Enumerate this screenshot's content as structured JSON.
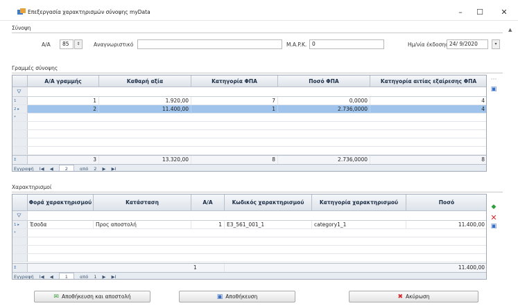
{
  "window": {
    "title": "Επεξεργασία χαρακτηρισμών σύνοψης myData",
    "controls": {
      "minimize": "–",
      "maximize": "☐",
      "close": "✕"
    }
  },
  "summary": {
    "label": "Σύνοψη",
    "aa_label": "Α/Α",
    "aa_value": "85",
    "id_label": "Αναγνωριστικό",
    "id_value": "",
    "mark_label": "M.A.P.K.",
    "mark_value": "0",
    "date_label": "Ημ/νία έκδοσης",
    "date_value": "24/ 9/2020"
  },
  "lines": {
    "label": "Γραμμές σύνοψης",
    "columns": [
      "Α/Α γραμμής",
      "Καθαρή αξία",
      "Κατηγορία ΦΠΑ",
      "Ποσό ΦΠΑ",
      "Κατηγορία αιτίας εξαίρεσης ΦΠΑ"
    ],
    "rows": [
      [
        "1",
        "1.920,00",
        "7",
        "0,0000",
        "4"
      ],
      [
        "2",
        "11.400,00",
        "1",
        "2.736,0000",
        "4"
      ]
    ],
    "selected_row": 1,
    "footer": [
      "3",
      "13.320,00",
      "8",
      "2.736,0000",
      "8"
    ],
    "nav": {
      "label": "Εγγραφή",
      "first": "I◀",
      "prev": "◀",
      "current": "2",
      "of": "από",
      "total": "2",
      "next": "▶",
      "last": "▶I"
    }
  },
  "characterizations": {
    "label": "Χαρακτηρισμοί",
    "columns": [
      "Φορά χαρακτηρισμού",
      "Κατάσταση",
      "Α/Α",
      "Κωδικός χαρακτηρισμού",
      "Κατηγορία χαρακτηρισμού",
      "Ποσό"
    ],
    "rows": [
      [
        "Έσοδα",
        "Προς αποστολή",
        "1",
        "E3_561_001_1",
        "category1_1",
        "11.400,00"
      ]
    ],
    "footer": [
      "",
      "",
      "1",
      "",
      "",
      "11.400,00"
    ],
    "nav": {
      "label": "Εγγραφή",
      "first": "I◀",
      "prev": "◀",
      "current": "1",
      "of": "από",
      "total": "1",
      "next": "▶",
      "last": "▶I"
    }
  },
  "buttons": {
    "save_send": "Αποθήκευση και αποστολή",
    "save": "Αποθήκευση",
    "cancel": "Ακύρωση"
  },
  "colors": {
    "selected_row": "#9fc3ea",
    "header": "#dde3ea",
    "add_icon": "#2e9d3b",
    "delete_icon": "#d6262b",
    "save_icon": "#3a6fc2"
  }
}
